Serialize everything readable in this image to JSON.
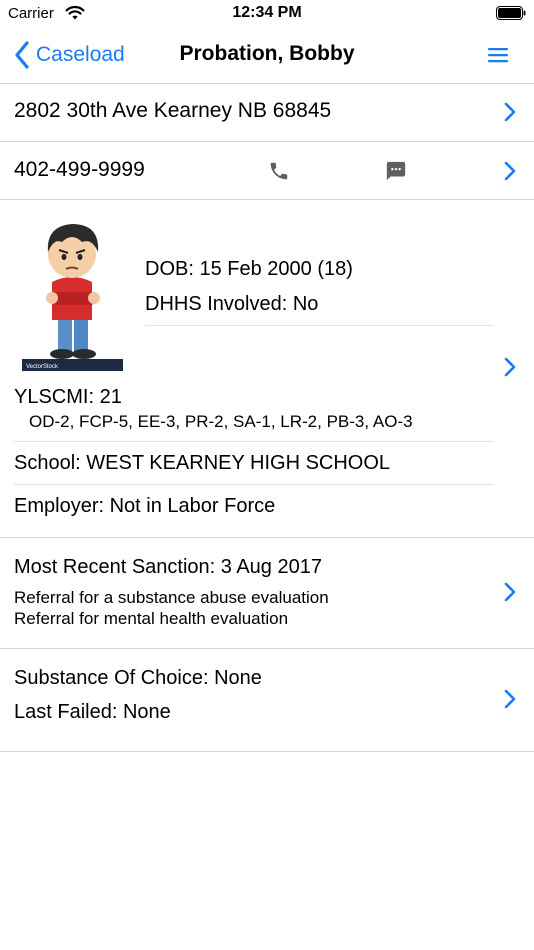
{
  "status_bar": {
    "carrier": "Carrier",
    "time": "12:34 PM"
  },
  "nav": {
    "back_label": "Caseload",
    "title": "Probation, Bobby",
    "accent_color": "#1a7cf5"
  },
  "address": {
    "text": "2802 30th Ave Kearney NB 68845"
  },
  "phone": {
    "number": "402-499-9999"
  },
  "profile": {
    "dob": "DOB: 15 Feb 2000 (18)",
    "dhhs": "DHHS Involved: No",
    "ylscmi": "YLSCMI: 21",
    "scores": "OD-2, FCP-5, EE-3, PR-2, SA-1, LR-2, PB-3, AO-3",
    "school": "School: WEST KEARNEY HIGH SCHOOL",
    "employer": "Employer: Not in Labor Force",
    "avatar_watermark": "VectorStock"
  },
  "sanction": {
    "title": "Most Recent Sanction: 3 Aug 2017",
    "items": [
      "Referral for a substance abuse evaluation",
      "Referral for mental health evaluation"
    ]
  },
  "substance": {
    "choice": "Substance Of Choice: None",
    "last_failed": "Last Failed: None"
  }
}
